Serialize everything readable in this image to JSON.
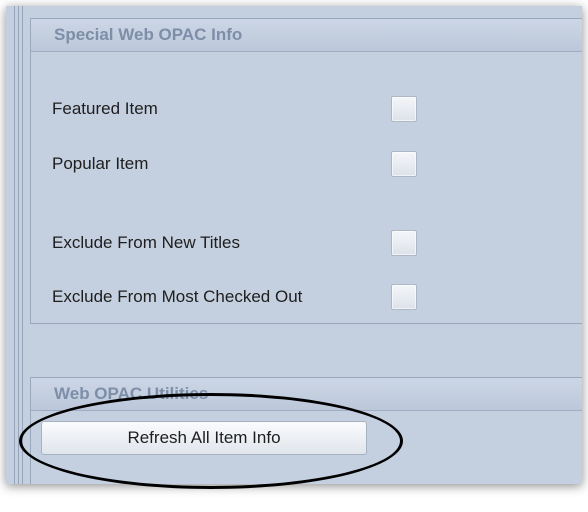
{
  "opac_info": {
    "title": "Special Web OPAC Info",
    "options": [
      {
        "label": "Featured Item",
        "checked": false
      },
      {
        "label": "Popular Item",
        "checked": false
      },
      {
        "label": "Exclude From New Titles",
        "checked": false
      },
      {
        "label": "Exclude From Most Checked Out",
        "checked": false
      }
    ]
  },
  "utilities": {
    "title": "Web OPAC Utilities",
    "refresh_button_label": "Refresh All Item Info"
  },
  "colors": {
    "panel_bg": "#c4cfdf",
    "header_text": "#7e8ea8",
    "highlight_ellipse": "#000000"
  }
}
